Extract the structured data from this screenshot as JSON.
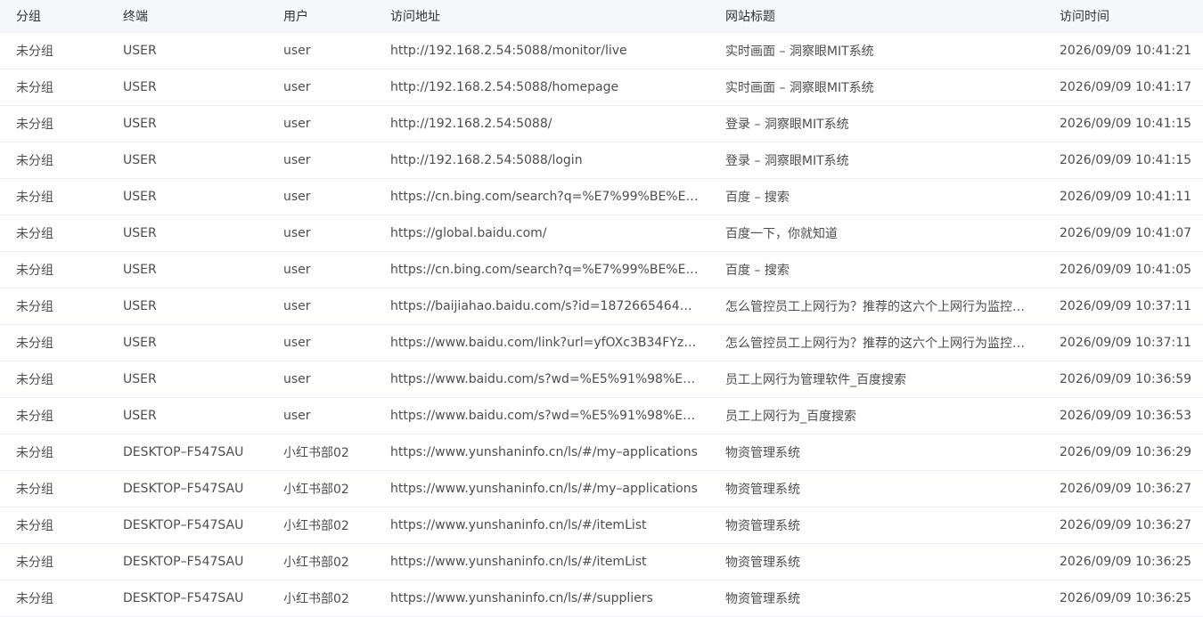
{
  "columns": {
    "group": "分组",
    "terminal": "终端",
    "user": "用户",
    "url": "访问地址",
    "title": "网站标题",
    "time": "访问时间"
  },
  "rows": [
    {
      "group": "未分组",
      "terminal": "USER",
      "user": "user",
      "url": "http://192.168.2.54:5088/monitor/live",
      "title": "实时画面 – 洞察眼MIT系统",
      "time": "2026/09/09 10:41:21"
    },
    {
      "group": "未分组",
      "terminal": "USER",
      "user": "user",
      "url": "http://192.168.2.54:5088/homepage",
      "title": "实时画面 – 洞察眼MIT系统",
      "time": "2026/09/09 10:41:17"
    },
    {
      "group": "未分组",
      "terminal": "USER",
      "user": "user",
      "url": "http://192.168.2.54:5088/",
      "title": "登录 – 洞察眼MIT系统",
      "time": "2026/09/09 10:41:15"
    },
    {
      "group": "未分组",
      "terminal": "USER",
      "user": "user",
      "url": "http://192.168.2.54:5088/login",
      "title": "登录 – 洞察眼MIT系统",
      "time": "2026/09/09 10:41:15"
    },
    {
      "group": "未分组",
      "terminal": "USER",
      "user": "user",
      "url": "https://cn.bing.com/search?q=%E7%99%BE%E5…",
      "title": "百度 – 搜索",
      "time": "2026/09/09 10:41:11"
    },
    {
      "group": "未分组",
      "terminal": "USER",
      "user": "user",
      "url": "https://global.baidu.com/",
      "title": "百度一下，你就知道",
      "time": "2026/09/09 10:41:07"
    },
    {
      "group": "未分组",
      "terminal": "USER",
      "user": "user",
      "url": "https://cn.bing.com/search?q=%E7%99%BE%E5…",
      "title": "百度 – 搜索",
      "time": "2026/09/09 10:41:05"
    },
    {
      "group": "未分组",
      "terminal": "USER",
      "user": "user",
      "url": "https://baijiahao.baidu.com/s?id=1872665464904…",
      "title": "怎么管控员工上网行为？推荐的这六个上网行为监控…",
      "time": "2026/09/09 10:37:11"
    },
    {
      "group": "未分组",
      "terminal": "USER",
      "user": "user",
      "url": "https://www.baidu.com/link?url=yfOXc3B34FYzsL…",
      "title": "怎么管控员工上网行为？推荐的这六个上网行为监控…",
      "time": "2026/09/09 10:37:11"
    },
    {
      "group": "未分组",
      "terminal": "USER",
      "user": "user",
      "url": "https://www.baidu.com/s?wd=%E5%91%98%E5…",
      "title": "员工上网行为管理软件_百度搜索",
      "time": "2026/09/09 10:36:59"
    },
    {
      "group": "未分组",
      "terminal": "USER",
      "user": "user",
      "url": "https://www.baidu.com/s?wd=%E5%91%98%E5…",
      "title": "员工上网行为_百度搜索",
      "time": "2026/09/09 10:36:53"
    },
    {
      "group": "未分组",
      "terminal": "DESKTOP–F547SAU",
      "user": "小红书部02",
      "url": "https://www.yunshaninfo.cn/ls/#/my–applications",
      "title": "物资管理系统",
      "time": "2026/09/09 10:36:29"
    },
    {
      "group": "未分组",
      "terminal": "DESKTOP–F547SAU",
      "user": "小红书部02",
      "url": "https://www.yunshaninfo.cn/ls/#/my–applications",
      "title": "物资管理系统",
      "time": "2026/09/09 10:36:27"
    },
    {
      "group": "未分组",
      "terminal": "DESKTOP–F547SAU",
      "user": "小红书部02",
      "url": "https://www.yunshaninfo.cn/ls/#/itemList",
      "title": "物资管理系统",
      "time": "2026/09/09 10:36:27"
    },
    {
      "group": "未分组",
      "terminal": "DESKTOP–F547SAU",
      "user": "小红书部02",
      "url": "https://www.yunshaninfo.cn/ls/#/itemList",
      "title": "物资管理系统",
      "time": "2026/09/09 10:36:25"
    },
    {
      "group": "未分组",
      "terminal": "DESKTOP–F547SAU",
      "user": "小红书部02",
      "url": "https://www.yunshaninfo.cn/ls/#/suppliers",
      "title": "物资管理系统",
      "time": "2026/09/09 10:36:25"
    }
  ]
}
